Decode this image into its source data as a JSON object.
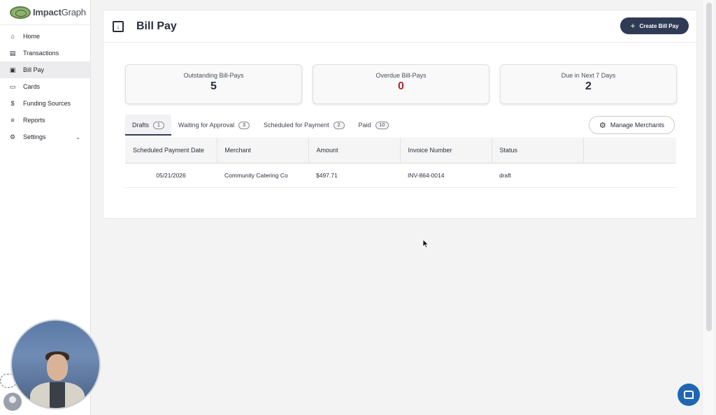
{
  "brand": {
    "name_bold": "Impact",
    "name_light": "Graph"
  },
  "sidebar": {
    "items": [
      {
        "label": "Home",
        "icon": "home-icon"
      },
      {
        "label": "Transactions",
        "icon": "receipt-icon"
      },
      {
        "label": "Bill Pay",
        "icon": "bill-icon",
        "active": true
      },
      {
        "label": "Cards",
        "icon": "card-icon"
      },
      {
        "label": "Funding Sources",
        "icon": "funding-icon"
      },
      {
        "label": "Reports",
        "icon": "reports-icon"
      },
      {
        "label": "Settings",
        "icon": "gear-icon",
        "has_submenu": true
      }
    ]
  },
  "header": {
    "title": "Bill Pay",
    "create_label": "Create Bill Pay"
  },
  "stats": [
    {
      "label": "Outstanding Bill-Pays",
      "value": "5"
    },
    {
      "label": "Overdue Bill-Pays",
      "value": "0",
      "color": "#b3262d"
    },
    {
      "label": "Due in Next 7 Days",
      "value": "2"
    }
  ],
  "tabs": [
    {
      "label": "Drafts",
      "count": "1",
      "active": true
    },
    {
      "label": "Waiting for Approval",
      "count": "3"
    },
    {
      "label": "Scheduled for Payment",
      "count": "2"
    },
    {
      "label": "Paid",
      "count": "10"
    }
  ],
  "manage_merchants_label": "Manage Merchants",
  "table": {
    "columns": [
      "Scheduled Payment Date",
      "Merchant",
      "Amount",
      "Invoice Number",
      "Status"
    ],
    "rows": [
      [
        "05/21/2026",
        "Community Catering Co",
        "$497.71",
        "INV-864-0014",
        "draft"
      ]
    ]
  },
  "colors": {
    "primary": "#2f3a55",
    "danger": "#b3262d",
    "chat": "#1f67b3"
  }
}
